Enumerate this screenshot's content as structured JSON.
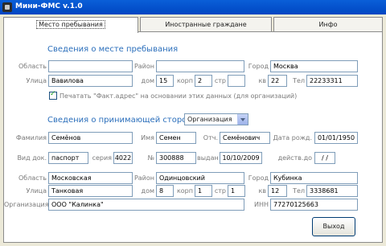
{
  "window": {
    "title": "Мини-ФМС v.1.0"
  },
  "tabs": [
    {
      "label": "Место пребывания",
      "active": true
    },
    {
      "label": "Иностранные граждане",
      "active": false
    },
    {
      "label": "Инфо",
      "active": false
    }
  ],
  "stay": {
    "title": "Сведения о месте пребывания",
    "region_label": "Область",
    "region_value": "",
    "district_label": "Район",
    "district_value": "",
    "city_label": "Город",
    "city_value": "Москва",
    "street_label": "Улица",
    "street_value": "Вавилова",
    "house_label": "дом",
    "house_value": "15",
    "korp_label": "корп",
    "korp_value": "2",
    "str_label": "стр",
    "str_value": "",
    "apt_label": "кв",
    "apt_value": "22",
    "phone_label": "Тел",
    "phone_value": "22233311",
    "print_fact_label": "Печатать \"Факт.адрес\" на основании этих данных (для организаций)"
  },
  "host": {
    "title": "Сведения о принимающей стороне",
    "type_value": "Организация",
    "surname_label": "Фамилия",
    "surname_value": "Семёнов",
    "name_label": "Имя",
    "name_value": "Семен",
    "patronymic_label": "Отч.",
    "patronymic_value": "Семёнович",
    "birth_label": "Дата рожд.",
    "birth_value": "01/01/1950",
    "doc_type_label": "Вид док.",
    "doc_type_value": "паспорт",
    "series_label": "серия",
    "series_value": "4022",
    "number_label": "№",
    "number_value": "300888",
    "issued_label": "выдан",
    "issued_value": "10/10/2009",
    "valid_until_label": "действ.до",
    "valid_until_value": "/ /",
    "region_label": "Область",
    "region_value": "Московская",
    "district_label": "Район",
    "district_value": "Одинцовский",
    "city_label": "Город",
    "city_value": "Кубинка",
    "street_label": "Улица",
    "street_value": "Танковая",
    "house_label": "дом",
    "house_value": "8",
    "korp_label": "корп",
    "korp_value": "1",
    "str_label": "стр",
    "str_value": "1",
    "apt_label": "кв",
    "apt_value": "12",
    "phone_label": "Тел",
    "phone_value": "3338681",
    "org_label": "Организация",
    "org_value": "ООО \"Калинка\"",
    "inn_label": "ИНН",
    "inn_value": "77270125663"
  },
  "buttons": {
    "exit_label": "Выход"
  }
}
